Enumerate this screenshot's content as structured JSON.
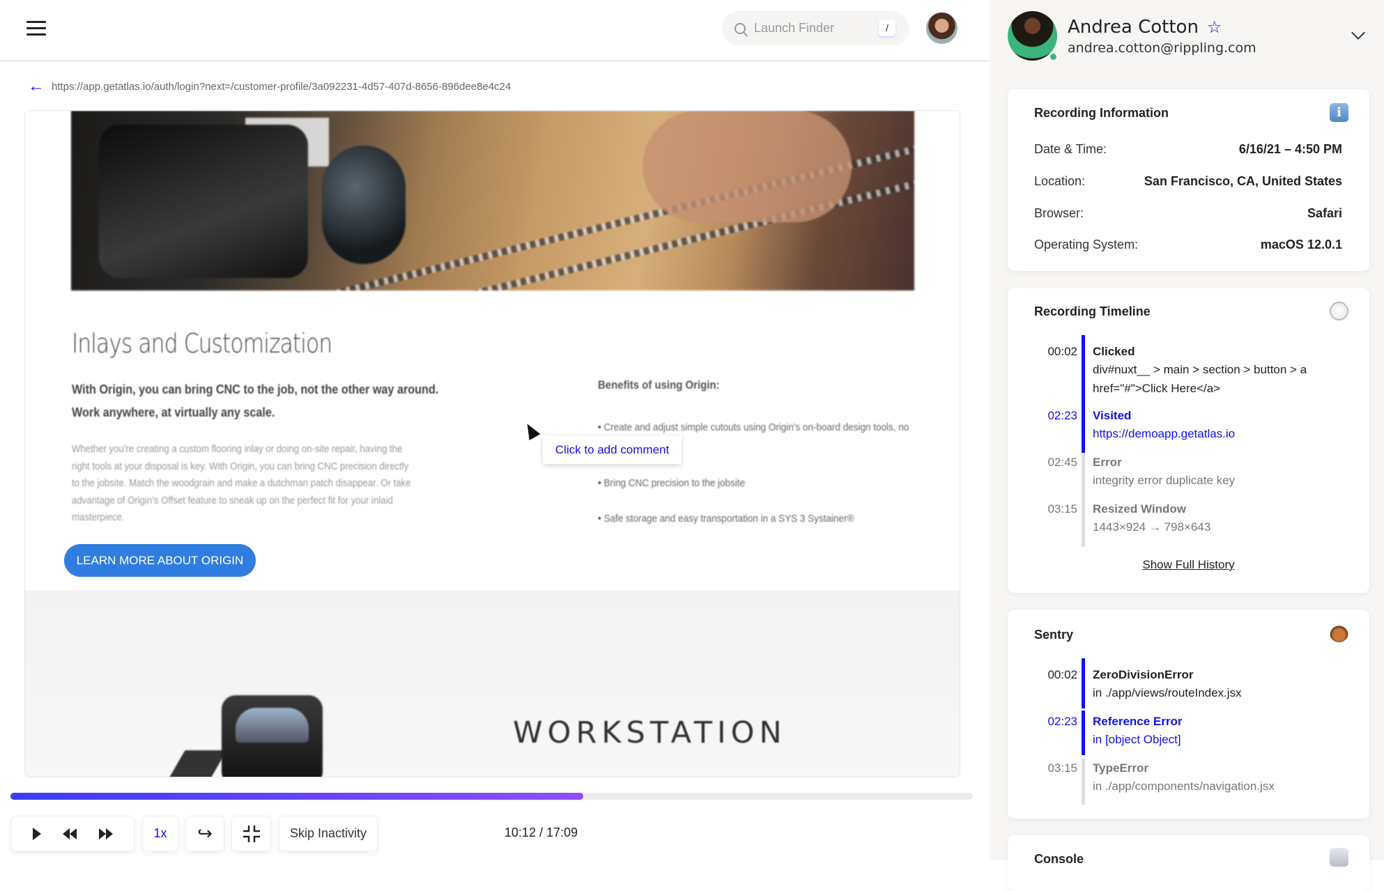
{
  "topbar": {
    "search_placeholder": "Launch Finder",
    "search_shortcut": "/"
  },
  "url": "https://app.getatlas.io/auth/login?next=/customer-profile/3a092231-4d57-407d-8656-896dee8e4c24",
  "page": {
    "heading": "Inlays and Customization",
    "subheading": "With Origin, you can bring CNC to the job, not the other way around. Work anywhere, at virtually any scale.",
    "paragraph": "Whether you're creating a custom flooring inlay or doing on-site repair, having the right tools at your disposal is key. With Origin, you can bring CNC precision directly to the jobsite. Match the woodgrain and make a dutchman patch disappear. Or take advantage of Origin's Offset feature to sneak up on the perfect fit for your inlaid masterpiece.",
    "benefits_title": "Benefits of using Origin:",
    "benefits": [
      "Create and adjust simple cutouts using Origin's on-board design tools, no computer required",
      "Bring CNC precision to the jobsite",
      "Safe storage and easy transportation in a SYS 3 Systainer®"
    ],
    "cta": "LEARN MORE ABOUT ORIGIN",
    "wordmark": "WORKSTATION",
    "comment_tooltip": "Click to add comment"
  },
  "player": {
    "progress": 0.595,
    "speed": "1x",
    "skip_label": "Skip Inactivity",
    "time": "10:12 / 17:09",
    "accent_start": "#3b3df0",
    "accent_end": "#8f4dfb"
  },
  "user": {
    "name": "Andrea Cotton",
    "email": "andrea.cotton@rippling.com",
    "status": "online"
  },
  "recording_info": {
    "title": "Recording Information",
    "icon": "info-icon",
    "rows": [
      {
        "label": "Date & Time:",
        "value": "6/16/21 – 4:50 PM"
      },
      {
        "label": "Location:",
        "value": "San Francisco, CA, United States"
      },
      {
        "label": "Browser:",
        "value": "Safari"
      },
      {
        "label": "Operating System:",
        "value": "macOS 12.0.1"
      }
    ]
  },
  "timeline": {
    "title": "Recording Timeline",
    "icon": "clock-icon",
    "events": [
      {
        "time": "00:02",
        "title": "Clicked",
        "detail": "div#nuxt__ > main > section > button > a href=\"#\">Click Here</a>"
      },
      {
        "time": "02:23",
        "title": "Visited",
        "detail": "https://demoapp.getatlas.io"
      },
      {
        "time": "02:45",
        "title": "Error",
        "detail": "integrity error duplicate key"
      },
      {
        "time": "03:15",
        "title": "Resized Window",
        "detail": "1443×924 → 798×643"
      }
    ],
    "show_full": "Show Full History"
  },
  "sentry": {
    "title": "Sentry",
    "icon": "ladybug-icon",
    "events": [
      {
        "time": "00:02",
        "title": "ZeroDivisionError",
        "detail": "in ./app/views/routeIndex.jsx"
      },
      {
        "time": "02:23",
        "title": "Reference Error",
        "detail": "in [object Object]"
      },
      {
        "time": "03:15",
        "title": "TypeError",
        "detail": "in ./app/components/navigation.jsx"
      }
    ]
  },
  "console": {
    "title": "Console",
    "icon": "robot-icon"
  },
  "colors": {
    "accent": "#1010ee",
    "cta": "#2f7de1",
    "panel_bg": "#f7f6f4"
  }
}
